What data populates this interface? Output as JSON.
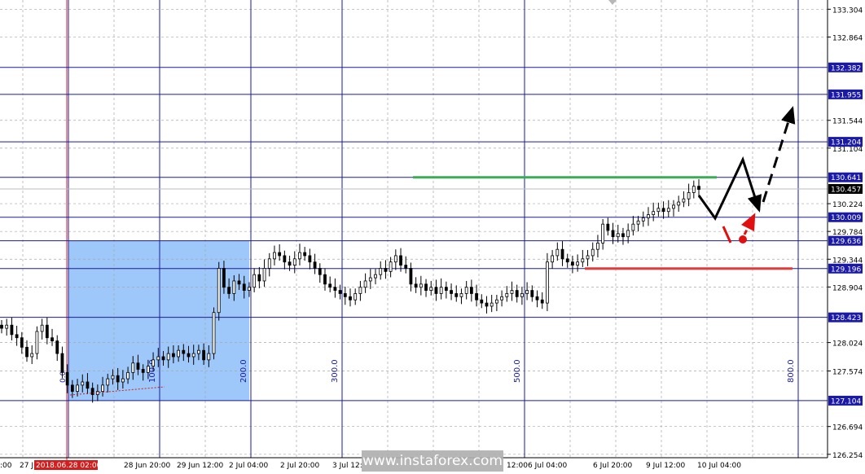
{
  "chart_data": {
    "type": "candlestick",
    "symbol_note": "",
    "y_range": [
      126.2,
      133.45
    ],
    "price_ticks": [
      133.304,
      132.864,
      131.544,
      131.104,
      130.224,
      129.784,
      129.344,
      128.904,
      128.024,
      127.574,
      126.694,
      126.254
    ],
    "level_lines": [
      {
        "value": 132.382,
        "label": "132.382"
      },
      {
        "value": 131.955,
        "label": "131.955"
      },
      {
        "value": 131.204,
        "label": "131.204"
      },
      {
        "value": 130.641,
        "label": "130.641"
      },
      {
        "value": 130.009,
        "label": "130.009"
      },
      {
        "value": 129.636,
        "label": "129.636"
      },
      {
        "value": 129.196,
        "label": "129.196"
      },
      {
        "value": 128.423,
        "label": "128.423"
      },
      {
        "value": 127.104,
        "label": "127.104"
      }
    ],
    "current_price": {
      "value": 130.457,
      "label": "130.457"
    },
    "time_labels": [
      "27 J",
      "2018.06.28 02:00",
      "28 Jun 20:00",
      "29 Jun 12:00",
      "2 Jul 04:00",
      "2 Jul 20:00",
      "3 Jul 12:",
      "6 Jul 04:00",
      "6 Jul 20:00",
      "9 Jul 12:00",
      "10 Jul 04:00"
    ],
    "left_time_label": ":00",
    "time_label_after_watermark": "12:00",
    "period_labels": [
      "100.0",
      "200.0",
      "300.0",
      "500.0",
      "800.0"
    ],
    "small_label": "0.0",
    "close_series": [
      128.25,
      128.3,
      128.15,
      128.1,
      127.95,
      127.8,
      127.85,
      128.2,
      128.3,
      128.1,
      128.05,
      127.85,
      127.55,
      127.35,
      127.25,
      127.35,
      127.4,
      127.3,
      127.2,
      127.25,
      127.35,
      127.45,
      127.5,
      127.4,
      127.45,
      127.55,
      127.7,
      127.6,
      127.55,
      127.65,
      127.75,
      127.8,
      127.75,
      127.85,
      127.8,
      127.9,
      127.85,
      127.8,
      127.85,
      127.9,
      127.75,
      127.85,
      128.5,
      129.2,
      128.9,
      128.8,
      129.0,
      128.95,
      128.85,
      128.9,
      129.1,
      129.0,
      129.2,
      129.35,
      129.45,
      129.4,
      129.3,
      129.25,
      129.35,
      129.45,
      129.4,
      129.3,
      129.2,
      129.1,
      128.95,
      128.9,
      128.85,
      128.8,
      128.75,
      128.7,
      128.8,
      128.9,
      129.0,
      129.05,
      129.1,
      129.2,
      129.15,
      129.3,
      129.4,
      129.25,
      129.2,
      128.95,
      128.9,
      128.95,
      128.85,
      128.9,
      128.8,
      128.9,
      128.85,
      128.8,
      128.75,
      128.8,
      128.9,
      128.8,
      128.7,
      128.65,
      128.6,
      128.65,
      128.7,
      128.75,
      128.8,
      128.85,
      128.75,
      128.8,
      128.85,
      128.75,
      128.7,
      128.65,
      129.3,
      129.4,
      129.5,
      129.35,
      129.3,
      129.25,
      129.3,
      129.35,
      129.4,
      129.5,
      129.6,
      129.9,
      129.8,
      129.7,
      129.75,
      129.7,
      129.8,
      129.9,
      129.95,
      130.0,
      130.05,
      130.1,
      130.15,
      130.1,
      130.15,
      130.2,
      130.25,
      130.3,
      130.4,
      130.5,
      130.45
    ],
    "forecast_paths": [
      {
        "color": "#000000",
        "style": "solid",
        "points": [
          [
            130.641,
            0
          ],
          [
            130.1,
            1
          ],
          [
            131.1,
            2
          ],
          [
            130.6,
            3
          ]
        ]
      },
      {
        "color": "#000000",
        "style": "dashed",
        "points": [
          [
            130.6,
            3
          ],
          [
            131.955,
            4
          ]
        ]
      },
      {
        "color": "#e01010",
        "style": "solid",
        "points": [
          [
            129.9,
            0
          ],
          [
            129.6,
            1
          ]
        ]
      },
      {
        "color": "#e01010",
        "style": "dashed",
        "points": [
          [
            129.7,
            1
          ],
          [
            130.05,
            2
          ]
        ]
      }
    ],
    "resistance_line": {
      "value": 130.641,
      "color": "#3cab58"
    },
    "support_line": {
      "value": 129.196,
      "color": "#e43a3a"
    },
    "highlight_box": {
      "from_price": 127.104,
      "to_price": 129.636,
      "color": "#92c2f8"
    },
    "diagonal_note": "dotted red trend line in box",
    "grid": true,
    "xlabel": "",
    "ylabel": ""
  },
  "watermark": {
    "text": "www.instaforex.com"
  }
}
